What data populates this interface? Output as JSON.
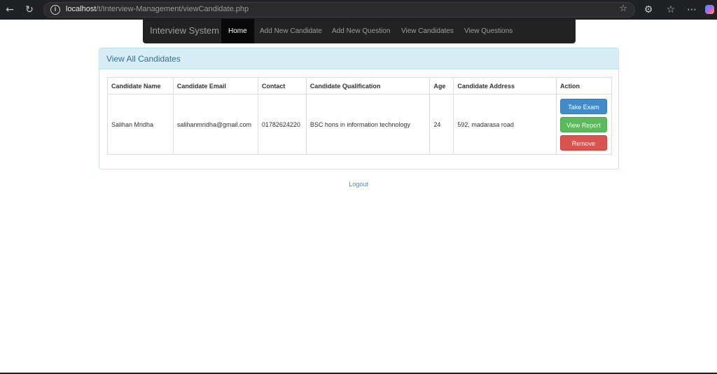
{
  "browser": {
    "url_host": "localhost",
    "url_path": "/t/Interview-Management/viewCandidate.php",
    "icons": {
      "back": "arrow-left-icon",
      "reload": "reload-icon",
      "info": "info-icon",
      "favorite": "star-icon",
      "extensions": "puzzle-icon",
      "favorites_list": "favorites-icon",
      "more": "more-icon",
      "copilot": "copilot-icon"
    }
  },
  "navbar": {
    "brand": "Interview System",
    "items": [
      {
        "label": "Home",
        "active": true
      },
      {
        "label": "Add New Candidate",
        "active": false
      },
      {
        "label": "Add New Question",
        "active": false
      },
      {
        "label": "View Candidates",
        "active": false
      },
      {
        "label": "View Questions",
        "active": false
      }
    ]
  },
  "panel": {
    "title": "View All Candidates",
    "table": {
      "headers": [
        "Candidate Name",
        "Candidate Email",
        "Contact",
        "Candidate Qualification",
        "Age",
        "Candidate Address",
        "Action"
      ],
      "rows": [
        {
          "name": "Salihan Mridha",
          "email": "salihanmridha@gmail.com",
          "contact": "01782624220",
          "qualification": "BSC hons in information technology",
          "age": "24",
          "address": "592, madarasa road",
          "actions": {
            "take_exam": "Take Exam",
            "view_report": "View Report",
            "remove": "Remove"
          }
        }
      ]
    }
  },
  "logout": "Logout",
  "colors": {
    "navbar_bg": "#222222",
    "navbar_active": "#080808",
    "panel_heading_bg": "#d9edf7",
    "panel_title": "#31708f",
    "btn_primary": "#428bca",
    "btn_success": "#5cb85c",
    "btn_danger": "#d9534f",
    "link": "#428bca"
  }
}
